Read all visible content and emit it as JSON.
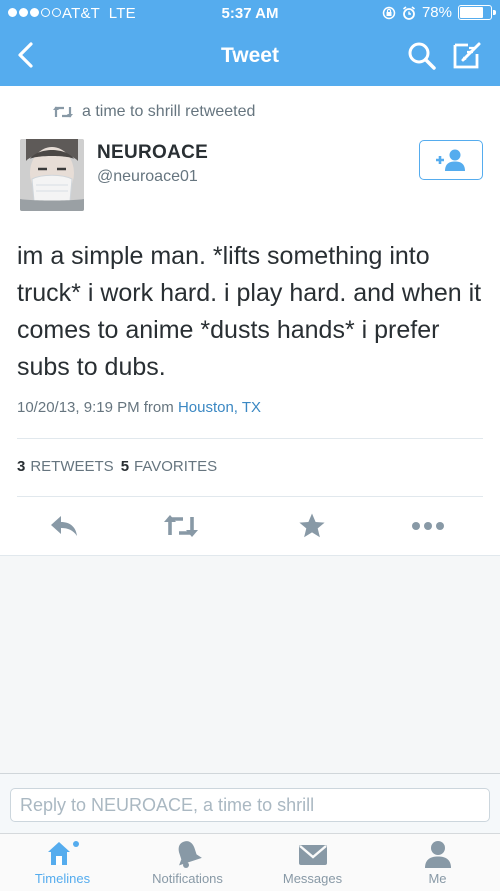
{
  "status_bar": {
    "carrier": "AT&T",
    "network": "LTE",
    "time": "5:37 AM",
    "battery": "78%",
    "battery_level": 0.78,
    "signal_bars_filled": 3,
    "signal_bars_total": 5,
    "icons": [
      "lock-rotation-icon",
      "alarm-icon",
      "battery-icon"
    ]
  },
  "nav": {
    "title": "Tweet",
    "back_icon": "chevron-left-icon",
    "search_icon": "search-icon",
    "compose_icon": "compose-icon"
  },
  "tweet": {
    "retweeted_by": "a time to shrill retweeted",
    "author_name": "NEUROACE",
    "author_handle": "@neuroace01",
    "follow_label": "+",
    "text": "im a simple man. *lifts something into truck* i work hard. i play hard. and when it comes to anime *dusts hands* i prefer subs to dubs.",
    "timestamp": "10/20/13, 9:19 PM",
    "from_label": "from",
    "location": "Houston, TX",
    "retweet_count": "3",
    "retweet_label": "RETWEETS",
    "favorite_count": "5",
    "favorite_label": "FAVORITES"
  },
  "actions": [
    "reply-icon",
    "retweet-icon",
    "favorite-icon",
    "more-icon"
  ],
  "reply": {
    "placeholder": "Reply to NEUROACE, a time to shrill"
  },
  "tabs": [
    {
      "label": "Timelines",
      "icon": "home-icon",
      "active": true
    },
    {
      "label": "Notifications",
      "icon": "bell-icon",
      "active": false
    },
    {
      "label": "Messages",
      "icon": "envelope-icon",
      "active": false
    },
    {
      "label": "Me",
      "icon": "person-icon",
      "active": false
    }
  ],
  "colors": {
    "accent": "#55acee",
    "text": "#292f33",
    "muted": "#66757f",
    "icon_gray": "#8899a6"
  }
}
